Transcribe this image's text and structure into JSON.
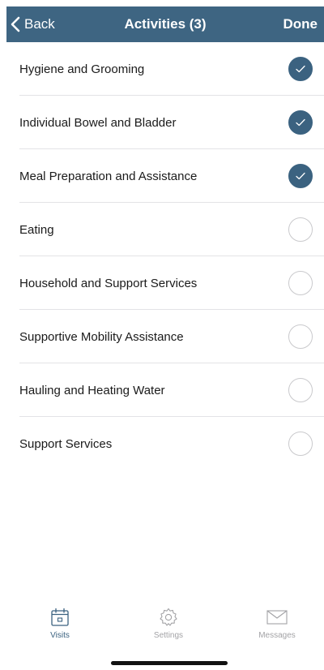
{
  "header": {
    "back_label": "Back",
    "title": "Activities (3)",
    "done_label": "Done",
    "background_color": "#3e6582"
  },
  "activities": [
    {
      "label": "Hygiene and Grooming",
      "checked": true
    },
    {
      "label": "Individual Bowel and Bladder",
      "checked": true
    },
    {
      "label": "Meal Preparation and Assistance",
      "checked": true
    },
    {
      "label": "Eating",
      "checked": false
    },
    {
      "label": "Household and Support Services",
      "checked": false
    },
    {
      "label": "Supportive Mobility Assistance",
      "checked": false
    },
    {
      "label": "Hauling and Heating Water",
      "checked": false
    },
    {
      "label": "Support Services",
      "checked": false
    }
  ],
  "tabbar": {
    "visits_label": "Visits",
    "settings_label": "Settings",
    "messages_label": "Messages",
    "active_tab": "Visits",
    "active_color": "#3b6280",
    "inactive_color": "#a3a3a6",
    "icons": {
      "visits": "calendar-icon",
      "settings": "gear-icon",
      "messages": "envelope-icon"
    }
  }
}
